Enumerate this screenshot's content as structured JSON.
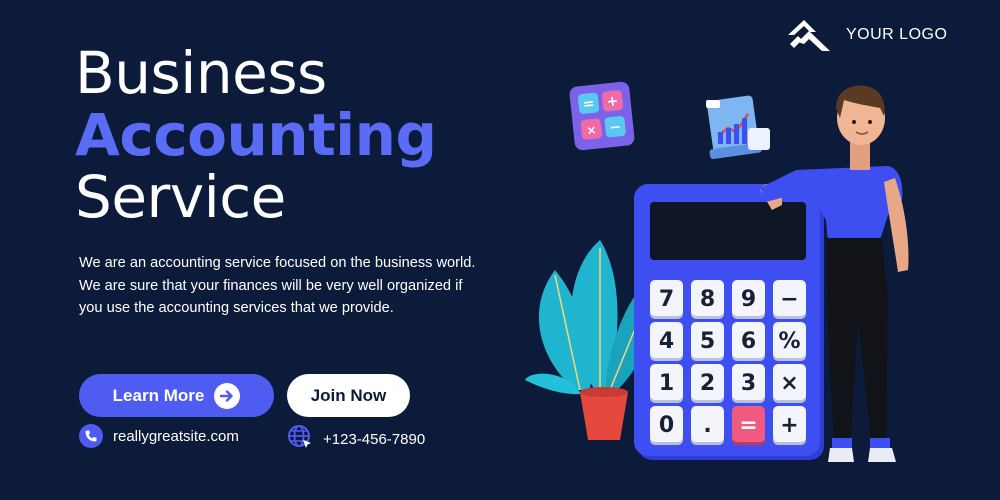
{
  "brand": {
    "logo_text": "YOUR LOGO"
  },
  "hero": {
    "title_line1": "Business",
    "title_line2": "Accounting",
    "title_line3": "Service",
    "description": "We are an accounting service focused on the business world. We are sure that your finances will be very well organized if you use the accounting services that we provide."
  },
  "buttons": {
    "learn_more": "Learn More",
    "join_now": "Join Now"
  },
  "contact": {
    "website": "reallygreatsite.com",
    "phone": "+123-456-7890"
  },
  "calculator": {
    "keys": [
      "7",
      "8",
      "9",
      "−",
      "4",
      "5",
      "6",
      "%",
      "1",
      "2",
      "3",
      "×",
      "0",
      ".",
      "=",
      "+"
    ]
  },
  "colors": {
    "background": "#0d1b3a",
    "accent": "#4e5cf2",
    "title_accent": "#5a6cf5",
    "calculator": "#3d4ff0",
    "leaf": "#1fb5cf",
    "pot": "#e5483f"
  }
}
